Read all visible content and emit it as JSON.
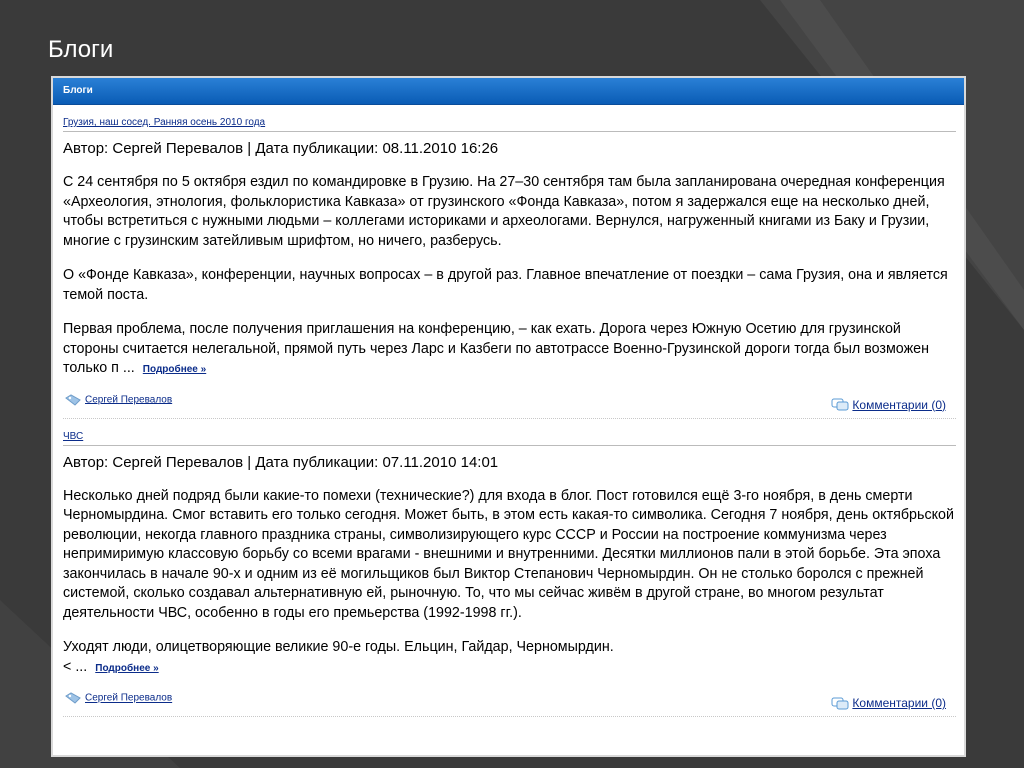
{
  "slide": {
    "title": "Блоги"
  },
  "panel": {
    "header": "Блоги"
  },
  "posts": [
    {
      "title": "Грузия, наш сосед. Ранняя осень 2010 года",
      "meta": "Автор: Сергей Перевалов | Дата публикации: 08.11.2010 16:26",
      "paragraphs": [
        "С 24 сентября по 5 октября ездил по командировке в Грузию. На 27–30 сентября там была запланирована очередная конференция «Археология, этнология, фольклористика Кавказа» от грузинского «Фонда Кавказа», потом я задержался еще на несколько дней, чтобы встретиться с нужными людьми – коллегами историками и археологами. Вернулся, нагруженный книгами из Баку и Грузии, многие с грузинским затейливым шрифтом, но ничего, разберусь.",
        "О «Фонде Кавказа», конференции, научных вопросах – в другой раз. Главное впечатление от поездки – сама Грузия, она и является темой поста.",
        "Первая проблема, после получения приглашения на конференцию, – как ехать. Дорога через Южную Осетию для грузинской стороны считается нелегальной, прямой путь через Ларс и Казбеги по автотрассе Военно-Грузинской дороги тогда был возможен только п ..."
      ],
      "more_label": "Подробнее »",
      "author_label": "Сергей Перевалов",
      "comments_label": "Комментарии (0)"
    },
    {
      "title": "ЧВС",
      "meta": "Автор: Сергей Перевалов | Дата публикации: 07.11.2010 14:01",
      "paragraphs": [
        "Несколько дней подряд были какие-то помехи (технические?) для входа в блог. Пост готовился ещё 3-го ноября, в день смерти Черномырдина. Смог вставить его только сегодня. Может быть, в этом есть какая-то символика. Сегодня 7 ноября, день октябрьской революции, некогда главного праздника страны, символизирующего курс СССР и России на построение коммунизма через непримиримую классовую борьбу со всеми врагами - внешними и внутренними. Десятки миллионов пали в этой борьбе. Эта эпоха закончилась в начале 90-х и одним из её могильщиков был Виктор Степанович Черномырдин. Он не столько боролся с прежней системой, сколько создавал альтернативную ей, рыночную. То, что мы сейчас живём в другой стране, во многом результат деятельности ЧВС, особенно в годы его премьерства (1992-1998 гг.).",
        "Уходят люди, олицетворяющие великие 90-е годы. Ельцин, Гайдар, Черномырдин.",
        "< ..."
      ],
      "more_label": "Подробнее »",
      "author_label": "Сергей Перевалов",
      "comments_label": "Комментарии (0)"
    }
  ],
  "icons": {
    "author": "tag-icon",
    "comments": "comment-bubble-icon"
  },
  "colors": {
    "header_blue": "#0a5cb5",
    "link": "#0b2c8a",
    "background": "#3a3a3a"
  }
}
